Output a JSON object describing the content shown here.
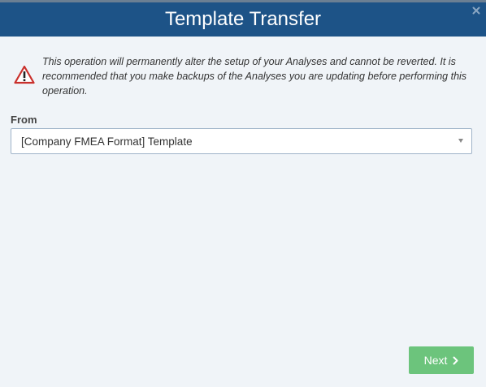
{
  "dialog": {
    "title": "Template Transfer",
    "close_icon": "close-icon",
    "header_color": "#1d5387"
  },
  "warning": {
    "icon": "warning-triangle-icon",
    "text": "This operation will permanently alter the setup of your Analyses and cannot be reverted. It is recommended that you make backups of the Analyses you are updating before performing this operation."
  },
  "from": {
    "label": "From",
    "selected_value": "[Company FMEA Format] Template"
  },
  "actions": {
    "next_label": "Next",
    "next_icon": "chevron-right-icon",
    "next_color": "#6cc47c"
  }
}
